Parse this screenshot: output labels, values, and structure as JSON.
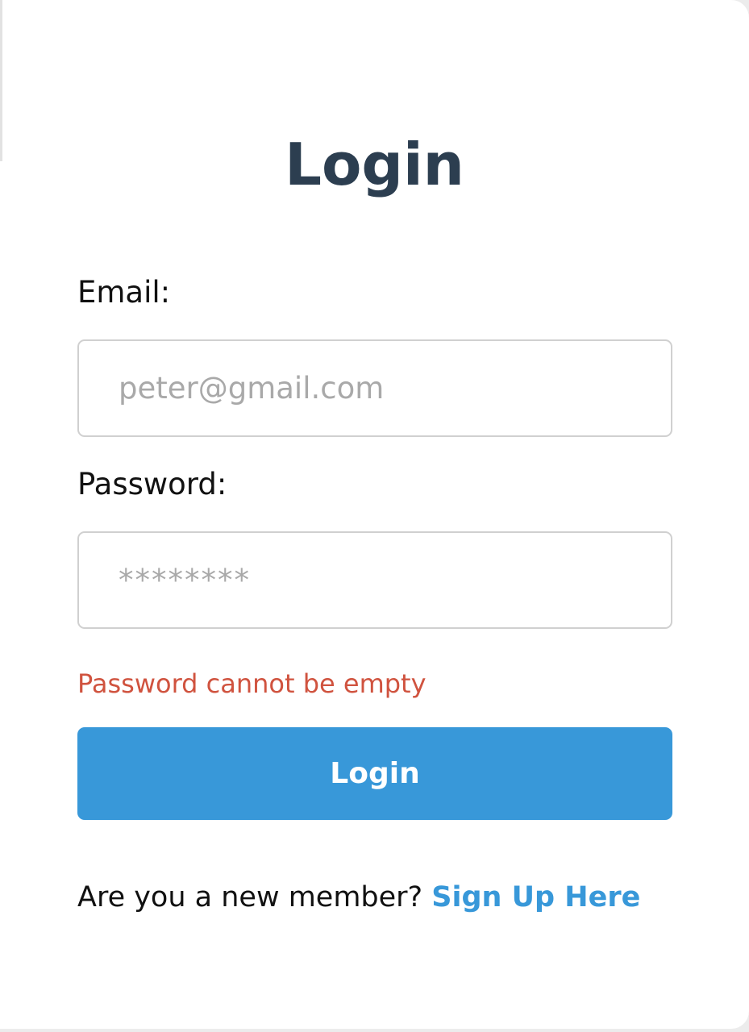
{
  "form": {
    "title": "Login",
    "email_label": "Email:",
    "email_placeholder": "peter@gmail.com",
    "password_label": "Password:",
    "password_placeholder": "********",
    "error_message": "Password cannot be empty",
    "submit_label": "Login",
    "signup_prompt": "Are you a new member?",
    "signup_link": "Sign Up Here"
  },
  "colors": {
    "title": "#2c3e50",
    "accent": "#3898d9",
    "error": "#d0533f",
    "placeholder": "#a9a9a9",
    "border": "#d0d0d0"
  }
}
